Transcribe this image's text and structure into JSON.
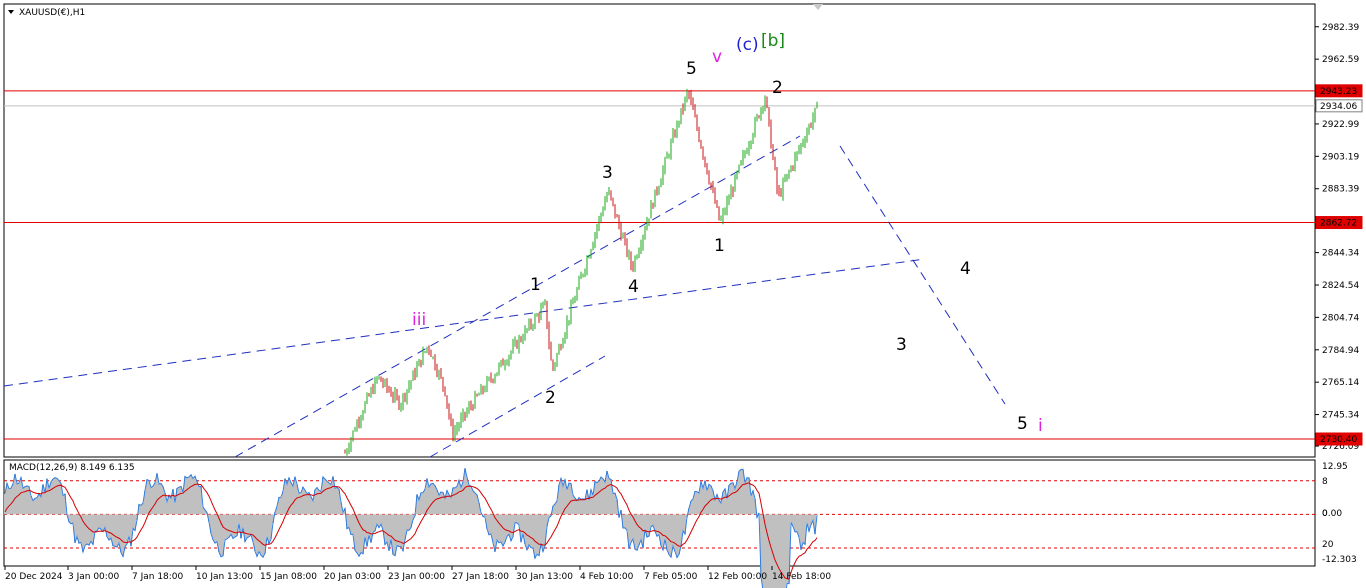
{
  "window": {
    "symbol_label": "XAUUSD(€),H1"
  },
  "colors": {
    "bull": "#1aaa1a",
    "bear": "#c81414",
    "hline": "#e00000",
    "trendline": "#1f2fbf",
    "hist": "#c0c0c0",
    "macd": "#2f7de1",
    "signal": "#d40000",
    "magenta": "#e020e0",
    "blue": "#1f1fcf",
    "green": "#1a8a1a",
    "black": "#000000"
  },
  "price_axis": {
    "range": [
      2719.4,
      2996.3
    ],
    "ticks": [
      "2982.39",
      "2962.59",
      "2943.23",
      "2934.06",
      "2922.99",
      "2903.19",
      "2883.39",
      "2863.12",
      "2844.34",
      "2824.54",
      "2804.74",
      "2784.94",
      "2765.14",
      "2745.34",
      "2730.40",
      "2726.09"
    ]
  },
  "price_tags": [
    {
      "label": "2943.23",
      "value": 2943.23,
      "style": "red"
    },
    {
      "label": "2934.06",
      "value": 2934.06,
      "style": "gray"
    },
    {
      "label": "2862.72",
      "value": 2862.72,
      "style": "red"
    },
    {
      "label": "2730.40",
      "value": 2730.4,
      "style": "red"
    }
  ],
  "time_axis": {
    "labels": [
      "20 Dec 2024",
      "3 Jan 00:00",
      "7 Jan 18:00",
      "10 Jan 13:00",
      "15 Jan 08:00",
      "20 Jan 03:00",
      "23 Jan 00:00",
      "27 Jan 18:00",
      "30 Jan 13:00",
      "4 Feb 10:00",
      "7 Feb 05:00",
      "12 Feb 00:00",
      "14 Feb 18:00"
    ]
  },
  "chart_data": {
    "type": "candlestick",
    "symbol": "XAUUSD(€)",
    "timeframe": "H1",
    "horizontal_levels": [
      2943.23,
      2862.72,
      2730.4
    ],
    "current_price": 2934.06,
    "path_anchors": [
      {
        "t": "27 Jan 18:00",
        "price": 2733
      },
      {
        "t": "29 Jan",
        "price": 2750
      },
      {
        "t": "30 Jan 13:00",
        "price": 2812
      },
      {
        "t": "31 Jan",
        "price": 2772
      },
      {
        "t": "4 Feb 10:00",
        "price": 2882
      },
      {
        "t": "5 Feb",
        "price": 2835
      },
      {
        "t": "7 Feb 05:00",
        "price": 2943
      },
      {
        "t": "12 Feb 00:00",
        "price": 2862
      },
      {
        "t": "13 Feb",
        "price": 2940
      },
      {
        "t": "14 Feb 18:00",
        "price": 2878
      },
      {
        "t": "last",
        "price": 2934
      }
    ],
    "projection": [
      {
        "label": "4",
        "price": 2842
      },
      {
        "label": "5",
        "price": 2752
      }
    ],
    "wave_labels": [
      {
        "text": "5",
        "color": "black"
      },
      {
        "text": "v",
        "color": "magenta"
      },
      {
        "text": "(c)",
        "color": "blue"
      },
      {
        "text": "[b]",
        "color": "green"
      },
      {
        "text": "2",
        "color": "black"
      },
      {
        "text": "3",
        "color": "black"
      },
      {
        "text": "1",
        "color": "black"
      },
      {
        "text": "4",
        "color": "black"
      },
      {
        "text": "1",
        "color": "black"
      },
      {
        "text": "iii",
        "color": "magenta"
      },
      {
        "text": "2",
        "color": "black"
      },
      {
        "text": "4",
        "color": "black"
      },
      {
        "text": "3",
        "color": "black"
      },
      {
        "text": "5",
        "color": "black"
      },
      {
        "text": "i",
        "color": "magenta"
      }
    ],
    "indicator": {
      "label": "MACD(12,26,9) 8.149 6.135",
      "params": [
        12,
        26,
        9
      ],
      "macd_value": 8.149,
      "signal_value": 6.135,
      "range": [
        -12.303,
        12.95
      ],
      "axis_ticks": [
        "12.95",
        "8",
        "0",
        "0.00",
        "20",
        "-12.303"
      ],
      "levels": [
        8,
        0,
        -8
      ]
    }
  }
}
